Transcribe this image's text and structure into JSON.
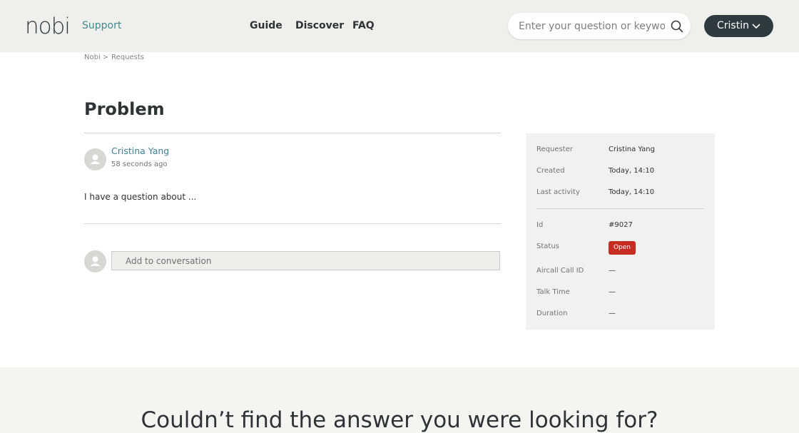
{
  "header": {
    "logo_text": "nobi",
    "support_label": "Support",
    "nav": [
      "Guide",
      "Discover",
      "FAQ"
    ],
    "search_placeholder": "Enter your question or keyword",
    "user_label": "Cristin",
    "colors": {
      "header_bg": "#efefeb",
      "accent": "#3d8a8e",
      "user_button_bg": "#2e3a3f"
    }
  },
  "breadcrumb": {
    "items": [
      "Nobi",
      "Requests"
    ],
    "separator": ">"
  },
  "request": {
    "title": "Problem",
    "comment": {
      "author": "Cristina Yang",
      "time": "58 seconds ago",
      "body": "I have a question about ..."
    },
    "reply_placeholder": "Add to conversation"
  },
  "details": {
    "requester_label": "Requester",
    "requester": "Cristina Yang",
    "created_label": "Created",
    "created": "Today, 14:10",
    "last_activity_label": "Last activity",
    "last_activity": "Today, 14:10",
    "id_label": "Id",
    "id": "#9027",
    "status_label": "Status",
    "status": "Open",
    "aircall_label": "Aircall Call ID",
    "aircall": "—",
    "talk_time_label": "Talk Time",
    "talk_time": "—",
    "duration_label": "Duration",
    "duration": "—",
    "status_color": "#c72c22"
  },
  "footer": {
    "heading": "Couldn’t find the answer you were looking for?"
  }
}
